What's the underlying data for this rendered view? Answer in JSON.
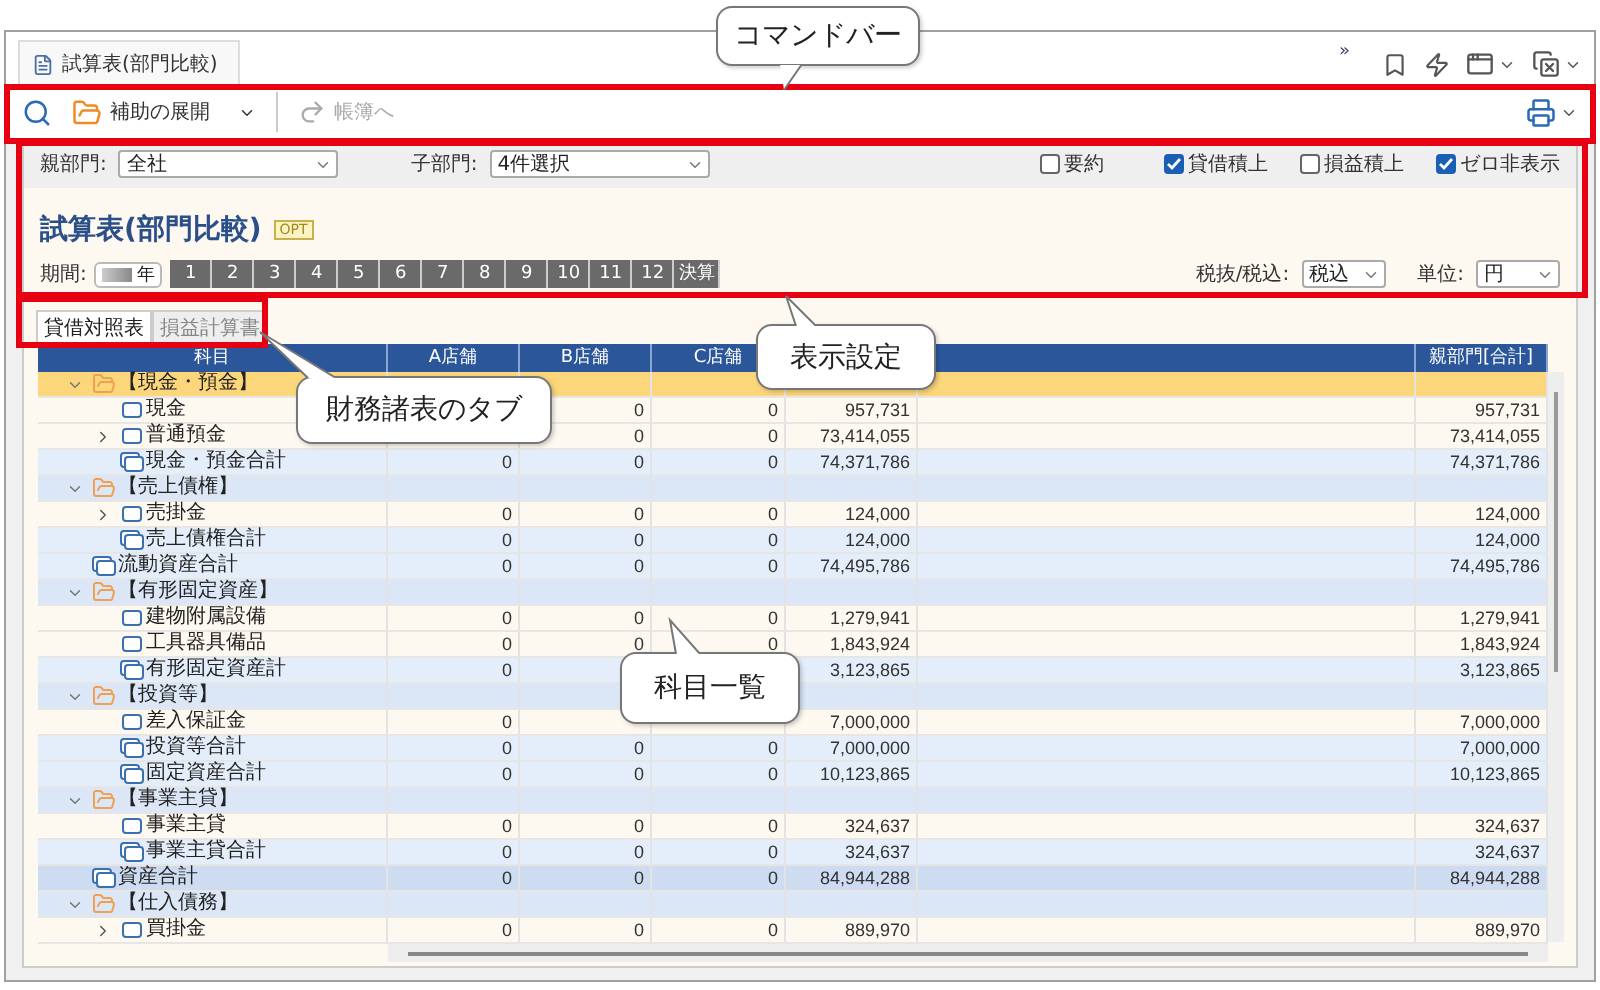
{
  "document_tab": {
    "title": "試算表(部門比較)"
  },
  "window_tools": {
    "overflow": "»"
  },
  "command_bar": {
    "expand_button": "補助の展開",
    "ledger_button": {
      "label": "帳簿へ",
      "disabled": true
    }
  },
  "filters": {
    "parent_dept": {
      "label": "親部門:",
      "value": "全社"
    },
    "child_dept": {
      "label": "子部門:",
      "value": "4件選択"
    },
    "options": [
      {
        "label": "要約",
        "checked": false
      },
      {
        "label": "貸借積上",
        "checked": true
      },
      {
        "label": "損益積上",
        "checked": false
      },
      {
        "label": "ゼロ非表示",
        "checked": true
      }
    ]
  },
  "report": {
    "title": "試算表(部門比較)",
    "badge": "OPT",
    "period_label": "期間:",
    "year_suffix": "年",
    "periods": [
      "1",
      "2",
      "3",
      "4",
      "5",
      "6",
      "7",
      "8",
      "9",
      "10",
      "11",
      "12",
      "決算"
    ],
    "tax": {
      "label": "税抜/税込:",
      "value": "税込"
    },
    "unit": {
      "label": "単位:",
      "value": "円"
    }
  },
  "statement_tabs": [
    {
      "label": "貸借対照表",
      "selected": true
    },
    {
      "label": "損益計算書",
      "selected": false
    }
  ],
  "table": {
    "columns": [
      "科目",
      "A店舗",
      "B店舗",
      "C店舗",
      null,
      null,
      "親部門[合計]"
    ],
    "rows": [
      {
        "kind": "group",
        "label": "【現金・預金】",
        "selected": true,
        "expanded": true,
        "children": [
          {
            "kind": "item",
            "label": "現金",
            "selected": false,
            "expandable": false,
            "values": {
              "b": "0",
              "c": "0",
              "d": "957,731",
              "total": "957,731"
            }
          },
          {
            "kind": "item",
            "label": "普通預金",
            "selected": false,
            "expandable": true,
            "values": {
              "b": "0",
              "c": "0",
              "d": "73,414,055",
              "total": "73,414,055"
            }
          },
          {
            "kind": "subtotal",
            "label": "現金・預金合計",
            "selected": false,
            "expandable": false,
            "values": {
              "a": "0",
              "b": "0",
              "c": "0",
              "d": "74,371,786",
              "total": "74,371,786"
            }
          }
        ]
      },
      {
        "kind": "group",
        "label": "【売上債権】",
        "selected": false,
        "expanded": true,
        "children": [
          {
            "kind": "item",
            "label": "売掛金",
            "selected": false,
            "expandable": true,
            "values": {
              "a": "0",
              "b": "0",
              "c": "0",
              "d": "124,000",
              "total": "124,000"
            }
          },
          {
            "kind": "subtotal",
            "label": "売上債権合計",
            "selected": false,
            "expandable": false,
            "values": {
              "a": "0",
              "b": "0",
              "c": "0",
              "d": "124,000",
              "total": "124,000"
            }
          }
        ]
      },
      {
        "kind": "subtotal",
        "label": "流動資産合計",
        "selected": false,
        "values": {
          "a": "0",
          "b": "0",
          "c": "0",
          "d": "74,495,786",
          "total": "74,495,786"
        }
      },
      {
        "kind": "group",
        "label": "【有形固定資産】",
        "selected": false,
        "expanded": true,
        "children": [
          {
            "kind": "item",
            "label": "建物附属設備",
            "selected": false,
            "expandable": false,
            "values": {
              "a": "0",
              "b": "0",
              "c": "0",
              "d": "1,279,941",
              "total": "1,279,941"
            }
          },
          {
            "kind": "item",
            "label": "工具器具備品",
            "selected": false,
            "expandable": false,
            "values": {
              "a": "0",
              "b": "0",
              "c": "0",
              "d": "1,843,924",
              "total": "1,843,924"
            }
          },
          {
            "kind": "subtotal",
            "label": "有形固定資産計",
            "selected": false,
            "expandable": false,
            "values": {
              "a": "0",
              "d": "3,123,865",
              "total": "3,123,865"
            }
          }
        ]
      },
      {
        "kind": "group",
        "label": "【投資等】",
        "selected": false,
        "expanded": true,
        "children": [
          {
            "kind": "item",
            "label": "差入保証金",
            "selected": false,
            "expandable": false,
            "values": {
              "a": "0",
              "d": "7,000,000",
              "total": "7,000,000"
            }
          },
          {
            "kind": "subtotal",
            "label": "投資等合計",
            "selected": false,
            "expandable": false,
            "values": {
              "a": "0",
              "b": "0",
              "c": "0",
              "d": "7,000,000",
              "total": "7,000,000"
            }
          },
          {
            "kind": "subtotal",
            "label": "固定資産合計",
            "selected": false,
            "expandable": false,
            "values": {
              "a": "0",
              "b": "0",
              "c": "0",
              "d": "10,123,865",
              "total": "10,123,865"
            }
          }
        ]
      },
      {
        "kind": "group",
        "label": "【事業主貸】",
        "selected": false,
        "expanded": true,
        "children": [
          {
            "kind": "item",
            "label": "事業主貸",
            "selected": false,
            "expandable": false,
            "values": {
              "a": "0",
              "b": "0",
              "c": "0",
              "d": "324,637",
              "total": "324,637"
            }
          },
          {
            "kind": "subtotal",
            "label": "事業主貸合計",
            "selected": false,
            "expandable": false,
            "values": {
              "a": "0",
              "b": "0",
              "c": "0",
              "d": "324,637",
              "total": "324,637"
            }
          }
        ]
      },
      {
        "kind": "grandtotal",
        "label": "資産合計",
        "selected": false,
        "values": {
          "a": "0",
          "b": "0",
          "c": "0",
          "d": "84,944,288",
          "total": "84,944,288"
        }
      },
      {
        "kind": "group",
        "label": "【仕入債務】",
        "selected": false,
        "expanded": true,
        "children": [
          {
            "kind": "item",
            "label": "買掛金",
            "selected": false,
            "expandable": true,
            "values": {
              "a": "0",
              "b": "0",
              "c": "0",
              "d": "889,970",
              "total": "889,970"
            }
          }
        ]
      }
    ]
  },
  "callouts": [
    {
      "text": "コマンドバー"
    },
    {
      "text": "表示設定"
    },
    {
      "text": "財務諸表のタブ"
    },
    {
      "text": "科目一覧"
    }
  ]
}
